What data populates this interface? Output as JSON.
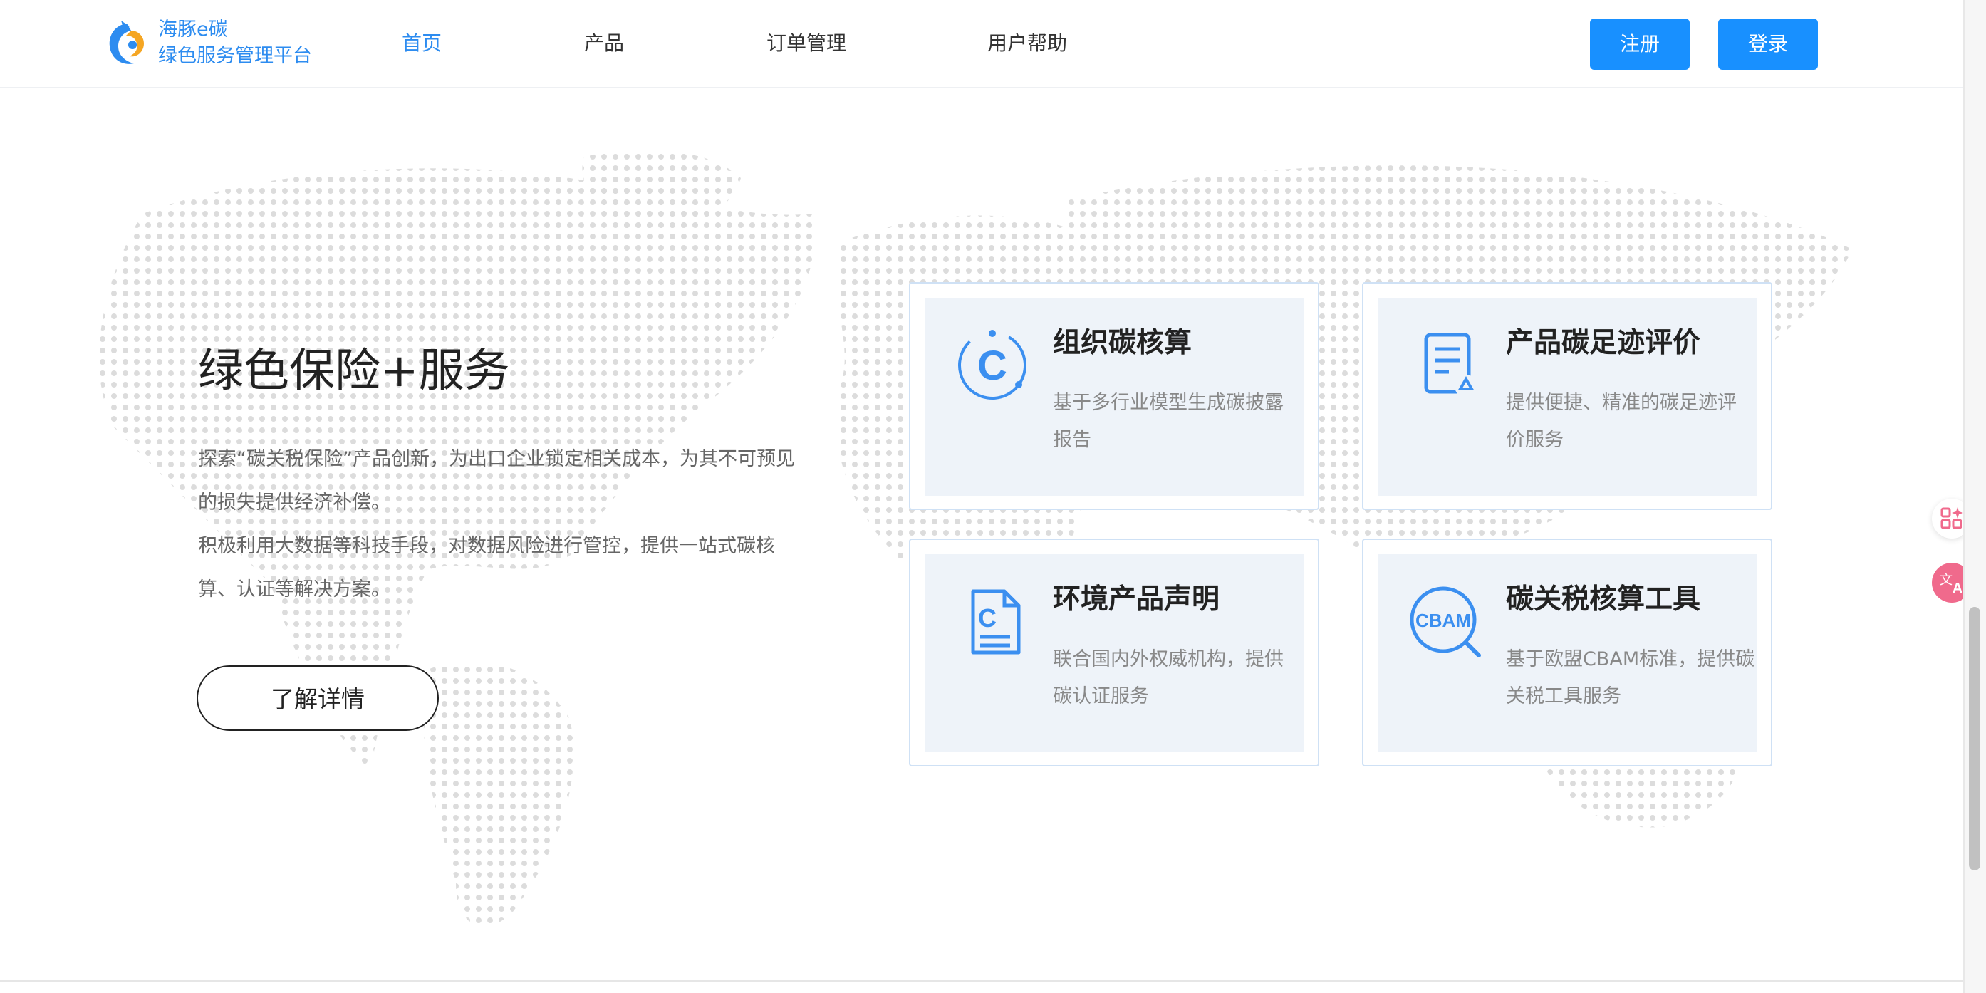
{
  "brand": {
    "name_line1": "海豚e碳",
    "name_line2": "绿色服务管理平台",
    "color": "#2d8cf0"
  },
  "nav": {
    "items": [
      {
        "label": "首页",
        "active": true
      },
      {
        "label": "产品",
        "active": false
      },
      {
        "label": "订单管理",
        "active": false
      },
      {
        "label": "用户帮助",
        "active": false
      }
    ]
  },
  "auth": {
    "register_label": "注册",
    "login_label": "登录",
    "button_color": "#1890ff"
  },
  "hero": {
    "title": "绿色保险+服务",
    "paragraphs": [
      "探索“碳关税保险”产品创新，为出口企业锁定相关成本，为其不可预见的损失提供经济补偿。",
      "积极利用大数据等科技手段，对数据风险进行管控，提供一站式碳核算、认证等解决方案。"
    ],
    "detail_button": "了解详情"
  },
  "cards": [
    {
      "title": "组织碳核算",
      "desc": "基于多行业模型生成碳披露报告",
      "icon": "carbon-c-icon"
    },
    {
      "title": "产品碳足迹评价",
      "desc": "提供便捷、精准的碳足迹评价服务",
      "icon": "recycle-document-icon"
    },
    {
      "title": "环境产品声明",
      "desc": "联合国内外权威机构，提供碳认证服务",
      "icon": "c-document-icon"
    },
    {
      "title": "碳关税核算工具",
      "desc": "基于欧盟CBAM标准，提供碳关税工具服务",
      "icon": "cbam-search-icon",
      "icon_text": "CBAM"
    }
  ],
  "floating": {
    "apps_icon": "apps-sparkle-icon",
    "translate_icon": "translate-icon"
  }
}
